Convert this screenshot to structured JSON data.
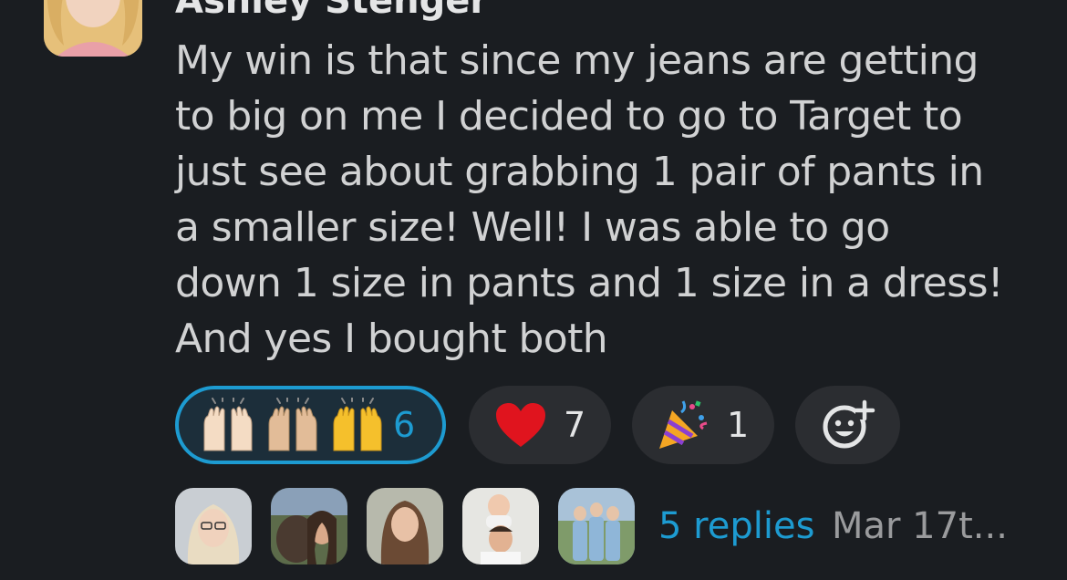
{
  "message": {
    "author": "Ashley Stenger",
    "text": "My win is that since my jeans are getting\nto big on me I decided to go to Target to\njust see about grabbing 1 pair of pants in\na smaller size! Well! I was able to go\ndown 1 size in pants and 1 size in a dress!\nAnd yes I bought both"
  },
  "reactions": [
    {
      "emoji": "raised-hands-icon",
      "count": "6",
      "selected": true
    },
    {
      "emoji": "heart-icon",
      "count": "7",
      "selected": false
    },
    {
      "emoji": "party-popper-icon",
      "count": "1",
      "selected": false
    },
    {
      "emoji": "add-reaction-icon",
      "count": "",
      "selected": false
    }
  ],
  "thread": {
    "replies_label": "5 replies",
    "timestamp": "Mar 17t..."
  },
  "colors": {
    "background": "#1a1d21",
    "link": "#1d9bd1",
    "pill": "#2b2d31",
    "text": "#d1d2d3",
    "muted": "#9a9b9d"
  }
}
